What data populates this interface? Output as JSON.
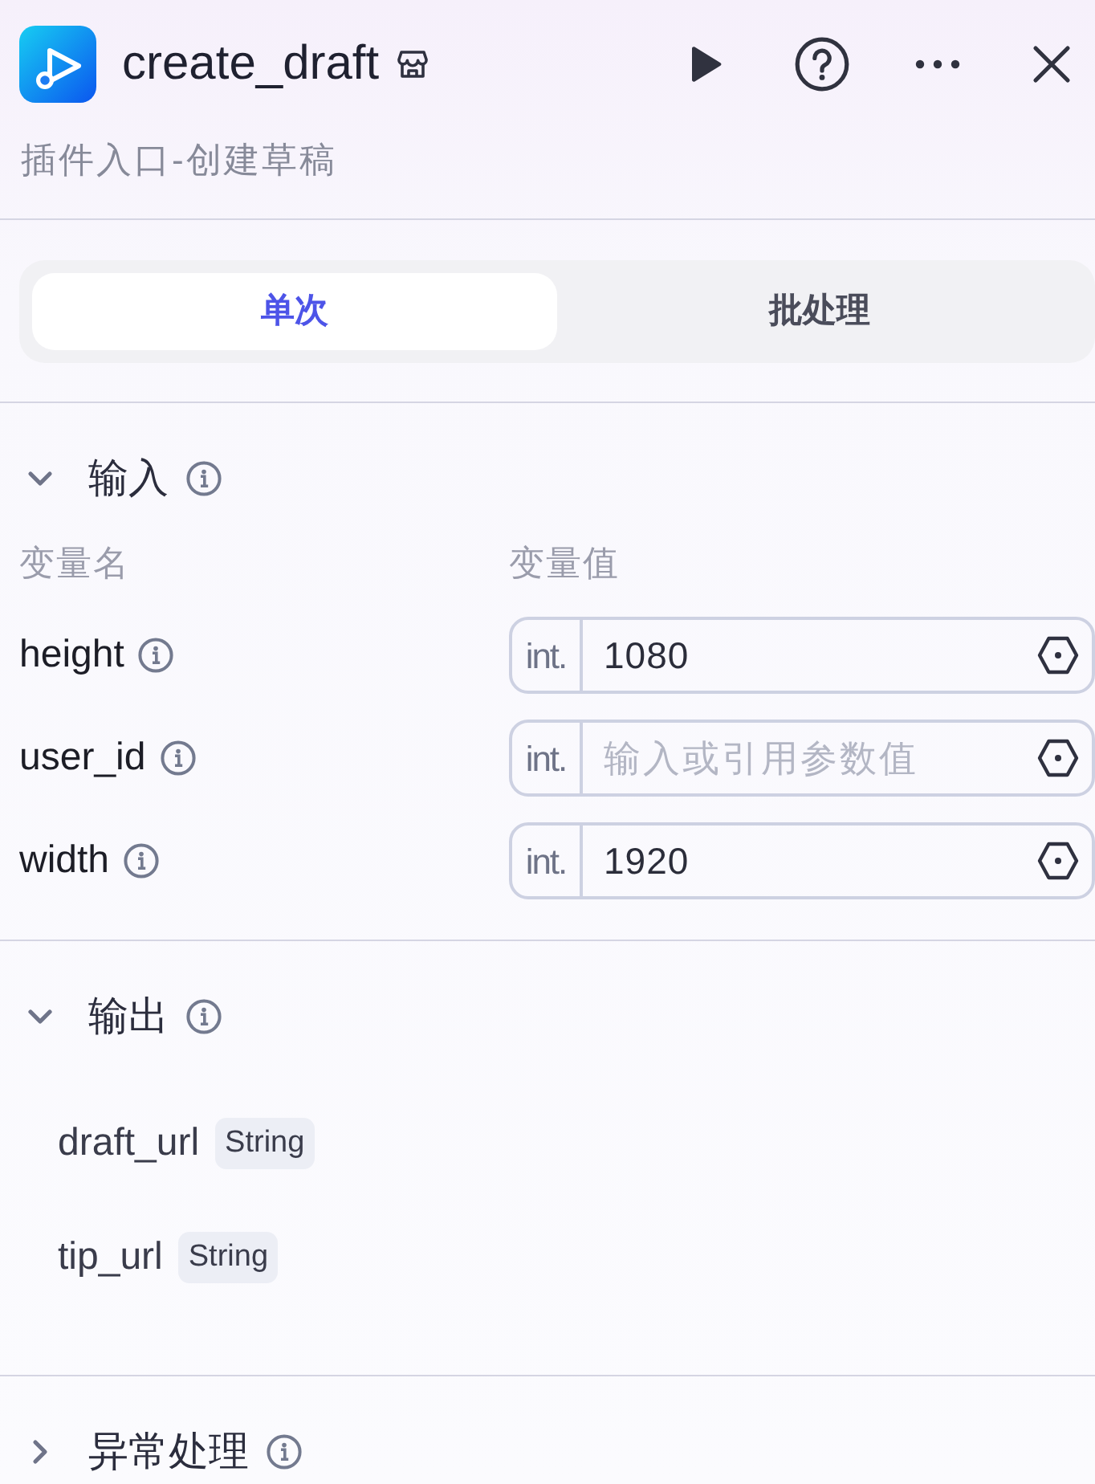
{
  "header": {
    "title": "create_draft",
    "subtitle": "插件入口-创建草稿"
  },
  "tabs": [
    {
      "label": "单次",
      "selected": true
    },
    {
      "label": "批处理",
      "selected": false
    }
  ],
  "sections": [
    {
      "kind": "inputs",
      "title": "输入",
      "expanded": true,
      "columns": [
        "变量名",
        "变量值"
      ],
      "params": [
        {
          "name": "height",
          "type": "int.",
          "value": "1080"
        },
        {
          "name": "user_id",
          "type": "int.",
          "placeholder": "输入或引用参数值"
        },
        {
          "name": "width",
          "type": "int.",
          "value": "1920"
        }
      ]
    },
    {
      "kind": "outputs",
      "title": "输出",
      "expanded": true,
      "fields": [
        {
          "name": "draft_url",
          "type": "String"
        },
        {
          "name": "tip_url",
          "type": "String"
        }
      ]
    },
    {
      "kind": "plain",
      "title": "异常处理",
      "expanded": false
    }
  ]
}
